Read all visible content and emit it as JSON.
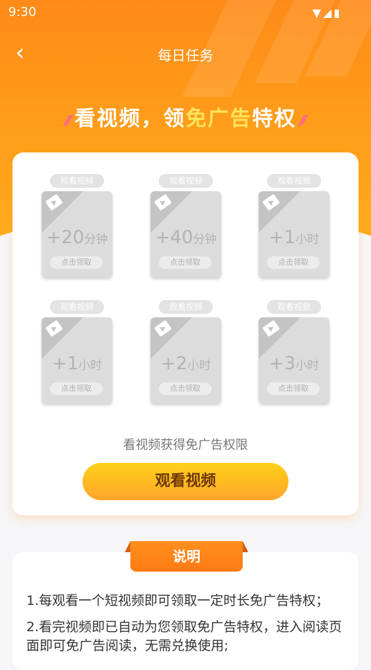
{
  "status": {
    "time": "9:30",
    "icons": "▼◢▮"
  },
  "nav": {
    "back": "‹",
    "title": "每日任务"
  },
  "headline": {
    "deco_left": "⁄⁄",
    "part1": "看视频，领",
    "highlight": "免广告",
    "part2": "特权",
    "deco_right": "⁄⁄"
  },
  "rewards": [
    {
      "tag": "观看视频",
      "num": "+20",
      "unit": "分钟",
      "claim": "点击领取"
    },
    {
      "tag": "观看视频",
      "num": "+40",
      "unit": "分钟",
      "claim": "点击领取"
    },
    {
      "tag": "观看视频",
      "num": "+1",
      "unit": "小时",
      "claim": "点击领取"
    },
    {
      "tag": "观看视频",
      "num": "+1",
      "unit": "小时",
      "claim": "点击领取"
    },
    {
      "tag": "观看视频",
      "num": "+2",
      "unit": "小时",
      "claim": "点击领取"
    },
    {
      "tag": "观看视频",
      "num": "+3",
      "unit": "小时",
      "claim": "点击领取"
    }
  ],
  "hint": "看视频获得免广告权限",
  "watch_button": "观看视频",
  "description": {
    "title": "说明",
    "lines": [
      "1.每观看一个短视频即可领取一定时长免广告特权；",
      "2.看完视频即已自动为您领取免广告特权，进入阅读页面即可免广告阅读，无需兑换使用;"
    ]
  },
  "colors": {
    "accent": "#ff8a18",
    "button": "#ffc21e"
  }
}
